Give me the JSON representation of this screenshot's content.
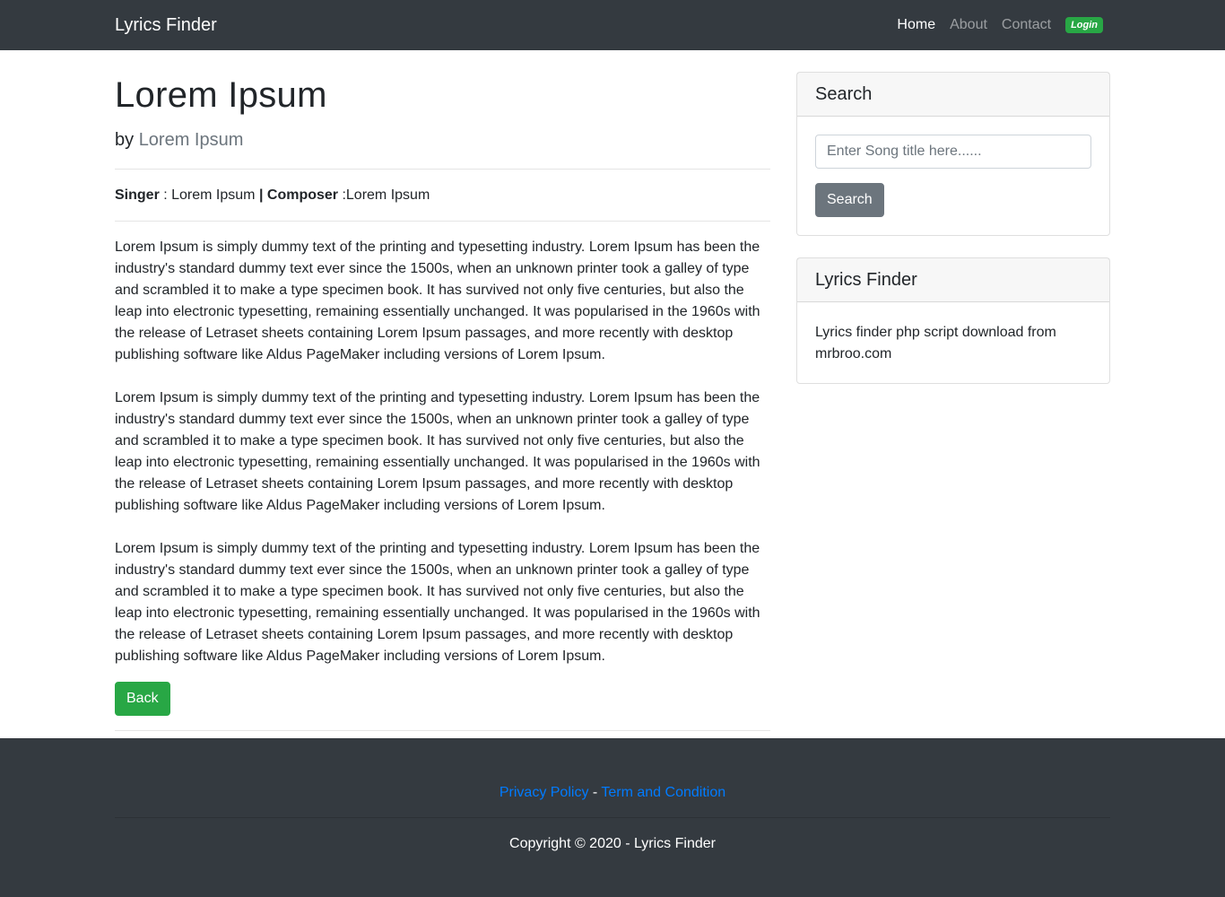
{
  "navbar": {
    "brand": "Lyrics Finder",
    "links": [
      {
        "label": "Home"
      },
      {
        "label": "About"
      },
      {
        "label": "Contact"
      }
    ],
    "login_label": "Login"
  },
  "post": {
    "title": "Lorem Ipsum",
    "by_prefix": "by ",
    "author": "Lorem Ipsum",
    "singer_label": "Singer",
    "singer_value": " : Lorem Ipsum ",
    "separator": "|",
    "composer_label": "Composer",
    "composer_value": " :Lorem Ipsum",
    "paragraphs": [
      "Lorem Ipsum is simply dummy text of the printing and typesetting industry. Lorem Ipsum has been the industry's standard dummy text ever since the 1500s, when an unknown printer took a galley of type and scrambled it to make a type specimen book. It has survived not only five centuries, but also the leap into electronic typesetting, remaining essentially unchanged. It was popularised in the 1960s with the release of Letraset sheets containing Lorem Ipsum passages, and more recently with desktop publishing software like Aldus PageMaker including versions of Lorem Ipsum.",
      "Lorem Ipsum is simply dummy text of the printing and typesetting industry. Lorem Ipsum has been the industry's standard dummy text ever since the 1500s, when an unknown printer took a galley of type and scrambled it to make a type specimen book. It has survived not only five centuries, but also the leap into electronic typesetting, remaining essentially unchanged. It was popularised in the 1960s with the release of Letraset sheets containing Lorem Ipsum passages, and more recently with desktop publishing software like Aldus PageMaker including versions of Lorem Ipsum.",
      "Lorem Ipsum is simply dummy text of the printing and typesetting industry. Lorem Ipsum has been the industry's standard dummy text ever since the 1500s, when an unknown printer took a galley of type and scrambled it to make a type specimen book. It has survived not only five centuries, but also the leap into electronic typesetting, remaining essentially unchanged. It was popularised in the 1960s with the release of Letraset sheets containing Lorem Ipsum passages, and more recently with desktop publishing software like Aldus PageMaker including versions of Lorem Ipsum."
    ],
    "back_label": "Back"
  },
  "sidebar": {
    "search_card": {
      "title": "Search",
      "placeholder": "Enter Song title here......",
      "button_label": "Search"
    },
    "info_card": {
      "title": "Lyrics Finder",
      "text": "Lyrics finder php script download from mrbroo.com"
    }
  },
  "footer": {
    "privacy_label": "Privacy Policy",
    "link_separator": " - ",
    "terms_label": "Term and Condition",
    "copyright": "Copyright © 2020 - Lyrics Finder"
  },
  "colors": {
    "navbar_bg": "#343a40",
    "success": "#28a745",
    "secondary": "#6c757d",
    "link": "#007bff"
  }
}
